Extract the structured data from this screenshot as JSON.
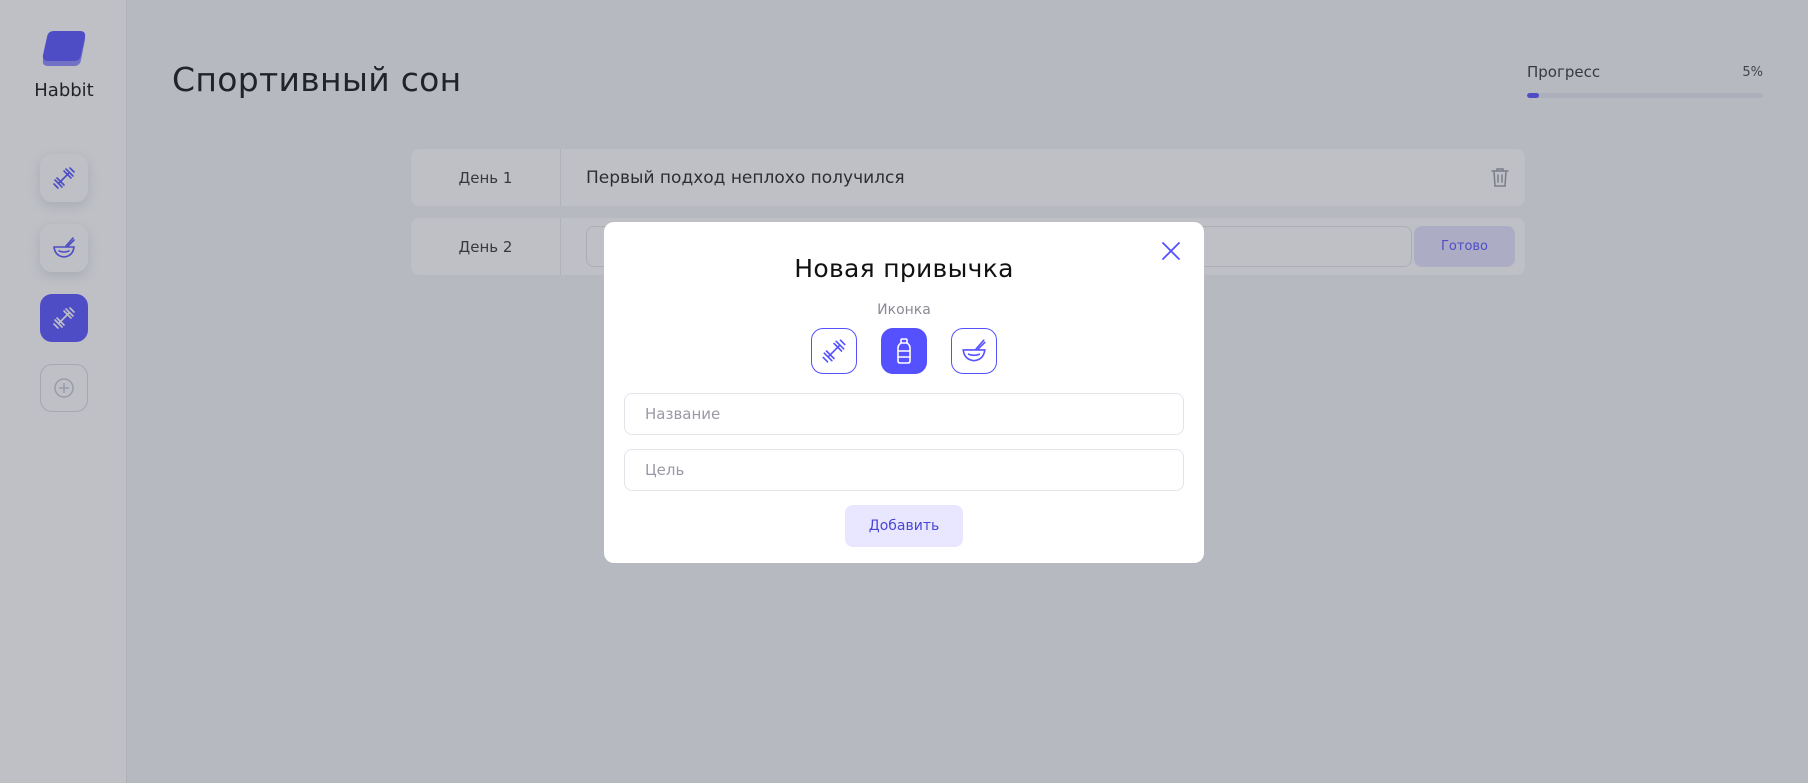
{
  "app": {
    "name": "Habbit"
  },
  "sidebar": {
    "items": [
      {
        "icon": "dumbbell-icon",
        "active": false
      },
      {
        "icon": "bowl-icon",
        "active": false
      },
      {
        "icon": "dumbbell-icon",
        "active": true
      },
      {
        "icon": "plus-circle-icon",
        "add": true
      }
    ]
  },
  "main": {
    "title": "Спортивный сон",
    "progress": {
      "label": "Прогресс",
      "value_text": "5%",
      "fraction": 0.05
    },
    "days": [
      {
        "label": "День 1",
        "text": "Первый подход неплохо получился"
      },
      {
        "label": "День 2",
        "input_value": "",
        "done_label": "Готово"
      }
    ]
  },
  "modal": {
    "title": "Новая привычка",
    "icons_label": "Иконка",
    "icon_options": [
      {
        "icon": "dumbbell-icon",
        "selected": false
      },
      {
        "icon": "bottle-icon",
        "selected": true
      },
      {
        "icon": "bowl-icon",
        "selected": false
      }
    ],
    "name_placeholder": "Название",
    "goal_placeholder": "Цель",
    "add_label": "Добавить"
  },
  "colors": {
    "accent": "#5551FF",
    "accent_light": "#E8E7FF",
    "background": "#F3F4F7",
    "overlay": "rgba(65,70,85,0.34)"
  }
}
